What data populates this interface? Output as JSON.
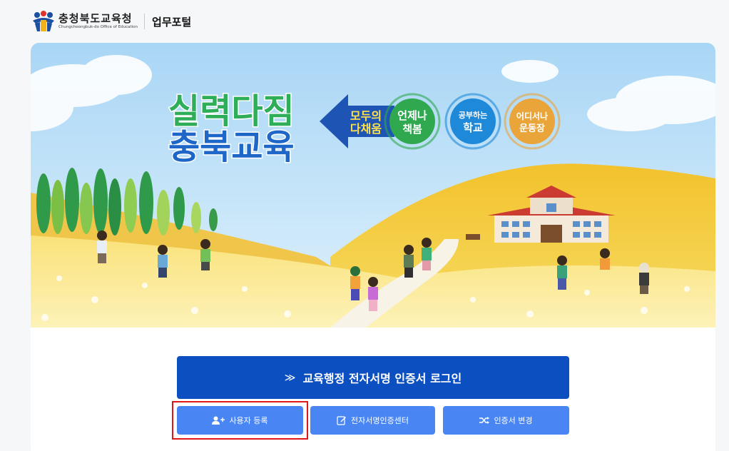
{
  "header": {
    "org_name_ko": "충청북도교육청",
    "org_name_en": "Chungcheongbuk-do Office of Education",
    "portal_title": "업무포털"
  },
  "banner": {
    "headline_line1": "실력다짐",
    "headline_line2": "충북교육",
    "arrow_text_line1": "모두의",
    "arrow_text_line2": "다채움",
    "circles": [
      {
        "line1": "언제나",
        "line2": "책봄",
        "color": "#2fa84f"
      },
      {
        "line1": "공부하는",
        "line2": "학교",
        "color": "#1e88d9"
      },
      {
        "line1": "어디서나",
        "line2": "운동장",
        "color": "#e9a43a"
      }
    ]
  },
  "actions": {
    "login_label": "교육행정 전자서명 인증서 로그인",
    "register_label": "사용자 등록",
    "cert_center_label": "전자서명인증센터",
    "change_cert_label": "인증서 변경"
  },
  "colors": {
    "primary": "#0b4fc1",
    "secondary": "#4a86f3",
    "highlight": "#e01717"
  }
}
